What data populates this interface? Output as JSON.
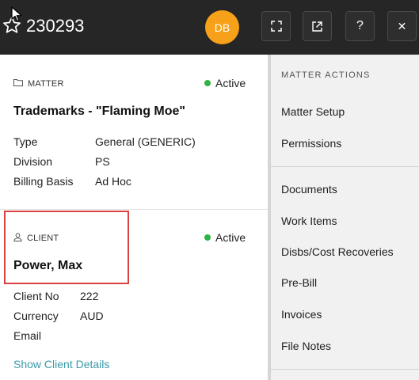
{
  "header": {
    "matter_number": "230293",
    "avatar_initials": "DB",
    "help_label": "?",
    "close_label": "✕"
  },
  "matter": {
    "section_label": "MATTER",
    "status": "Active",
    "title": "Trademarks - \"Flaming Moe\"",
    "fields": [
      {
        "label": "Type",
        "value": "General (GENERIC)"
      },
      {
        "label": "Division",
        "value": "PS"
      },
      {
        "label": "Billing Basis",
        "value": "Ad Hoc"
      }
    ]
  },
  "client": {
    "section_label": "CLIENT",
    "status": "Active",
    "name": "Power, Max",
    "fields": [
      {
        "label": "Client No",
        "value": "222"
      },
      {
        "label": "Currency",
        "value": "AUD"
      },
      {
        "label": "Email",
        "value": ""
      }
    ],
    "details_link": "Show Client Details"
  },
  "actions": {
    "title": "MATTER ACTIONS",
    "group1": [
      "Matter Setup",
      "Permissions"
    ],
    "group2": [
      "Documents",
      "Work Items",
      "Disbs/Cost Recoveries",
      "Pre-Bill",
      "Invoices",
      "File Notes"
    ]
  },
  "colors": {
    "header_bg": "#262626",
    "avatar_bg": "#f7a11a",
    "status_active": "#2fb344",
    "link": "#3a9aa8",
    "highlight_border": "#d9423e",
    "actions_bg": "#f1f1f1"
  },
  "icons": {
    "favorite": "star-outline-icon",
    "expand": "fullscreen-icon",
    "open_external": "open-external-icon",
    "matter": "folder-icon",
    "client": "person-icon"
  }
}
